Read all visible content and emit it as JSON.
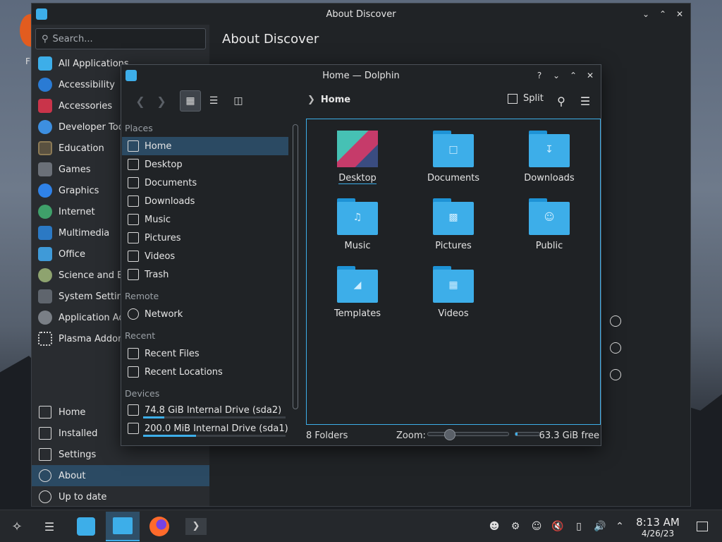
{
  "desktop": {
    "partial_label": "F"
  },
  "discover": {
    "title": "About Discover",
    "search_placeholder": "Search...",
    "categories": [
      {
        "label": "All Applications",
        "icon": "grid-icon"
      },
      {
        "label": "Accessibility",
        "icon": "accessibility-icon"
      },
      {
        "label": "Accessories",
        "icon": "toolbox-icon"
      },
      {
        "label": "Developer Too",
        "icon": "wrench-icon"
      },
      {
        "label": "Education",
        "icon": "chalkboard-icon"
      },
      {
        "label": "Games",
        "icon": "gamepad-icon"
      },
      {
        "label": "Graphics",
        "icon": "paint-icon"
      },
      {
        "label": "Internet",
        "icon": "globe-icon"
      },
      {
        "label": "Multimedia",
        "icon": "media-icon"
      },
      {
        "label": "Office",
        "icon": "office-icon"
      },
      {
        "label": "Science and En",
        "icon": "flask-icon"
      },
      {
        "label": "System Setting",
        "icon": "system-icon"
      },
      {
        "label": "Application Ad",
        "icon": "addon-icon"
      },
      {
        "label": "Plasma Addon",
        "icon": "plasma-icon"
      }
    ],
    "bottom_nav": [
      {
        "label": "Home",
        "icon": "home-icon"
      },
      {
        "label": "Installed",
        "icon": "installed-icon"
      },
      {
        "label": "Settings",
        "icon": "settings-icon"
      },
      {
        "label": "About",
        "icon": "info-icon"
      },
      {
        "label": "Up to date",
        "icon": "update-icon"
      }
    ],
    "main_title": "About Discover"
  },
  "dolphin": {
    "title": "Home — Dolphin",
    "breadcrumb": "Home",
    "split_label": "Split",
    "places_sections": {
      "places": "Places",
      "remote": "Remote",
      "recent": "Recent",
      "devices": "Devices"
    },
    "places": [
      "Home",
      "Desktop",
      "Documents",
      "Downloads",
      "Music",
      "Pictures",
      "Videos",
      "Trash"
    ],
    "remote": [
      "Network"
    ],
    "recent": [
      "Recent Files",
      "Recent Locations"
    ],
    "devices": [
      {
        "label": "74.8 GiB Internal Drive (sda2)",
        "usage": 0.15
      },
      {
        "label": "200.0 MiB Internal Drive (sda1)",
        "usage": 0.37
      }
    ],
    "files": [
      {
        "name": "Desktop",
        "icon": "desktop-folder-icon"
      },
      {
        "name": "Documents",
        "icon": "documents-folder-icon"
      },
      {
        "name": "Downloads",
        "icon": "downloads-folder-icon"
      },
      {
        "name": "Music",
        "icon": "music-folder-icon"
      },
      {
        "name": "Pictures",
        "icon": "pictures-folder-icon"
      },
      {
        "name": "Public",
        "icon": "public-folder-icon"
      },
      {
        "name": "Templates",
        "icon": "templates-folder-icon"
      },
      {
        "name": "Videos",
        "icon": "videos-folder-icon"
      }
    ],
    "status": {
      "folders": "8 Folders",
      "zoom_label": "Zoom:",
      "free": "63.3 GiB free",
      "free_fraction": 0.1
    }
  },
  "taskbar": {
    "time": "8:13 AM",
    "date": "4/26/23"
  },
  "colors": {
    "accent": "#3daee9",
    "selection": "#2b4a63"
  }
}
